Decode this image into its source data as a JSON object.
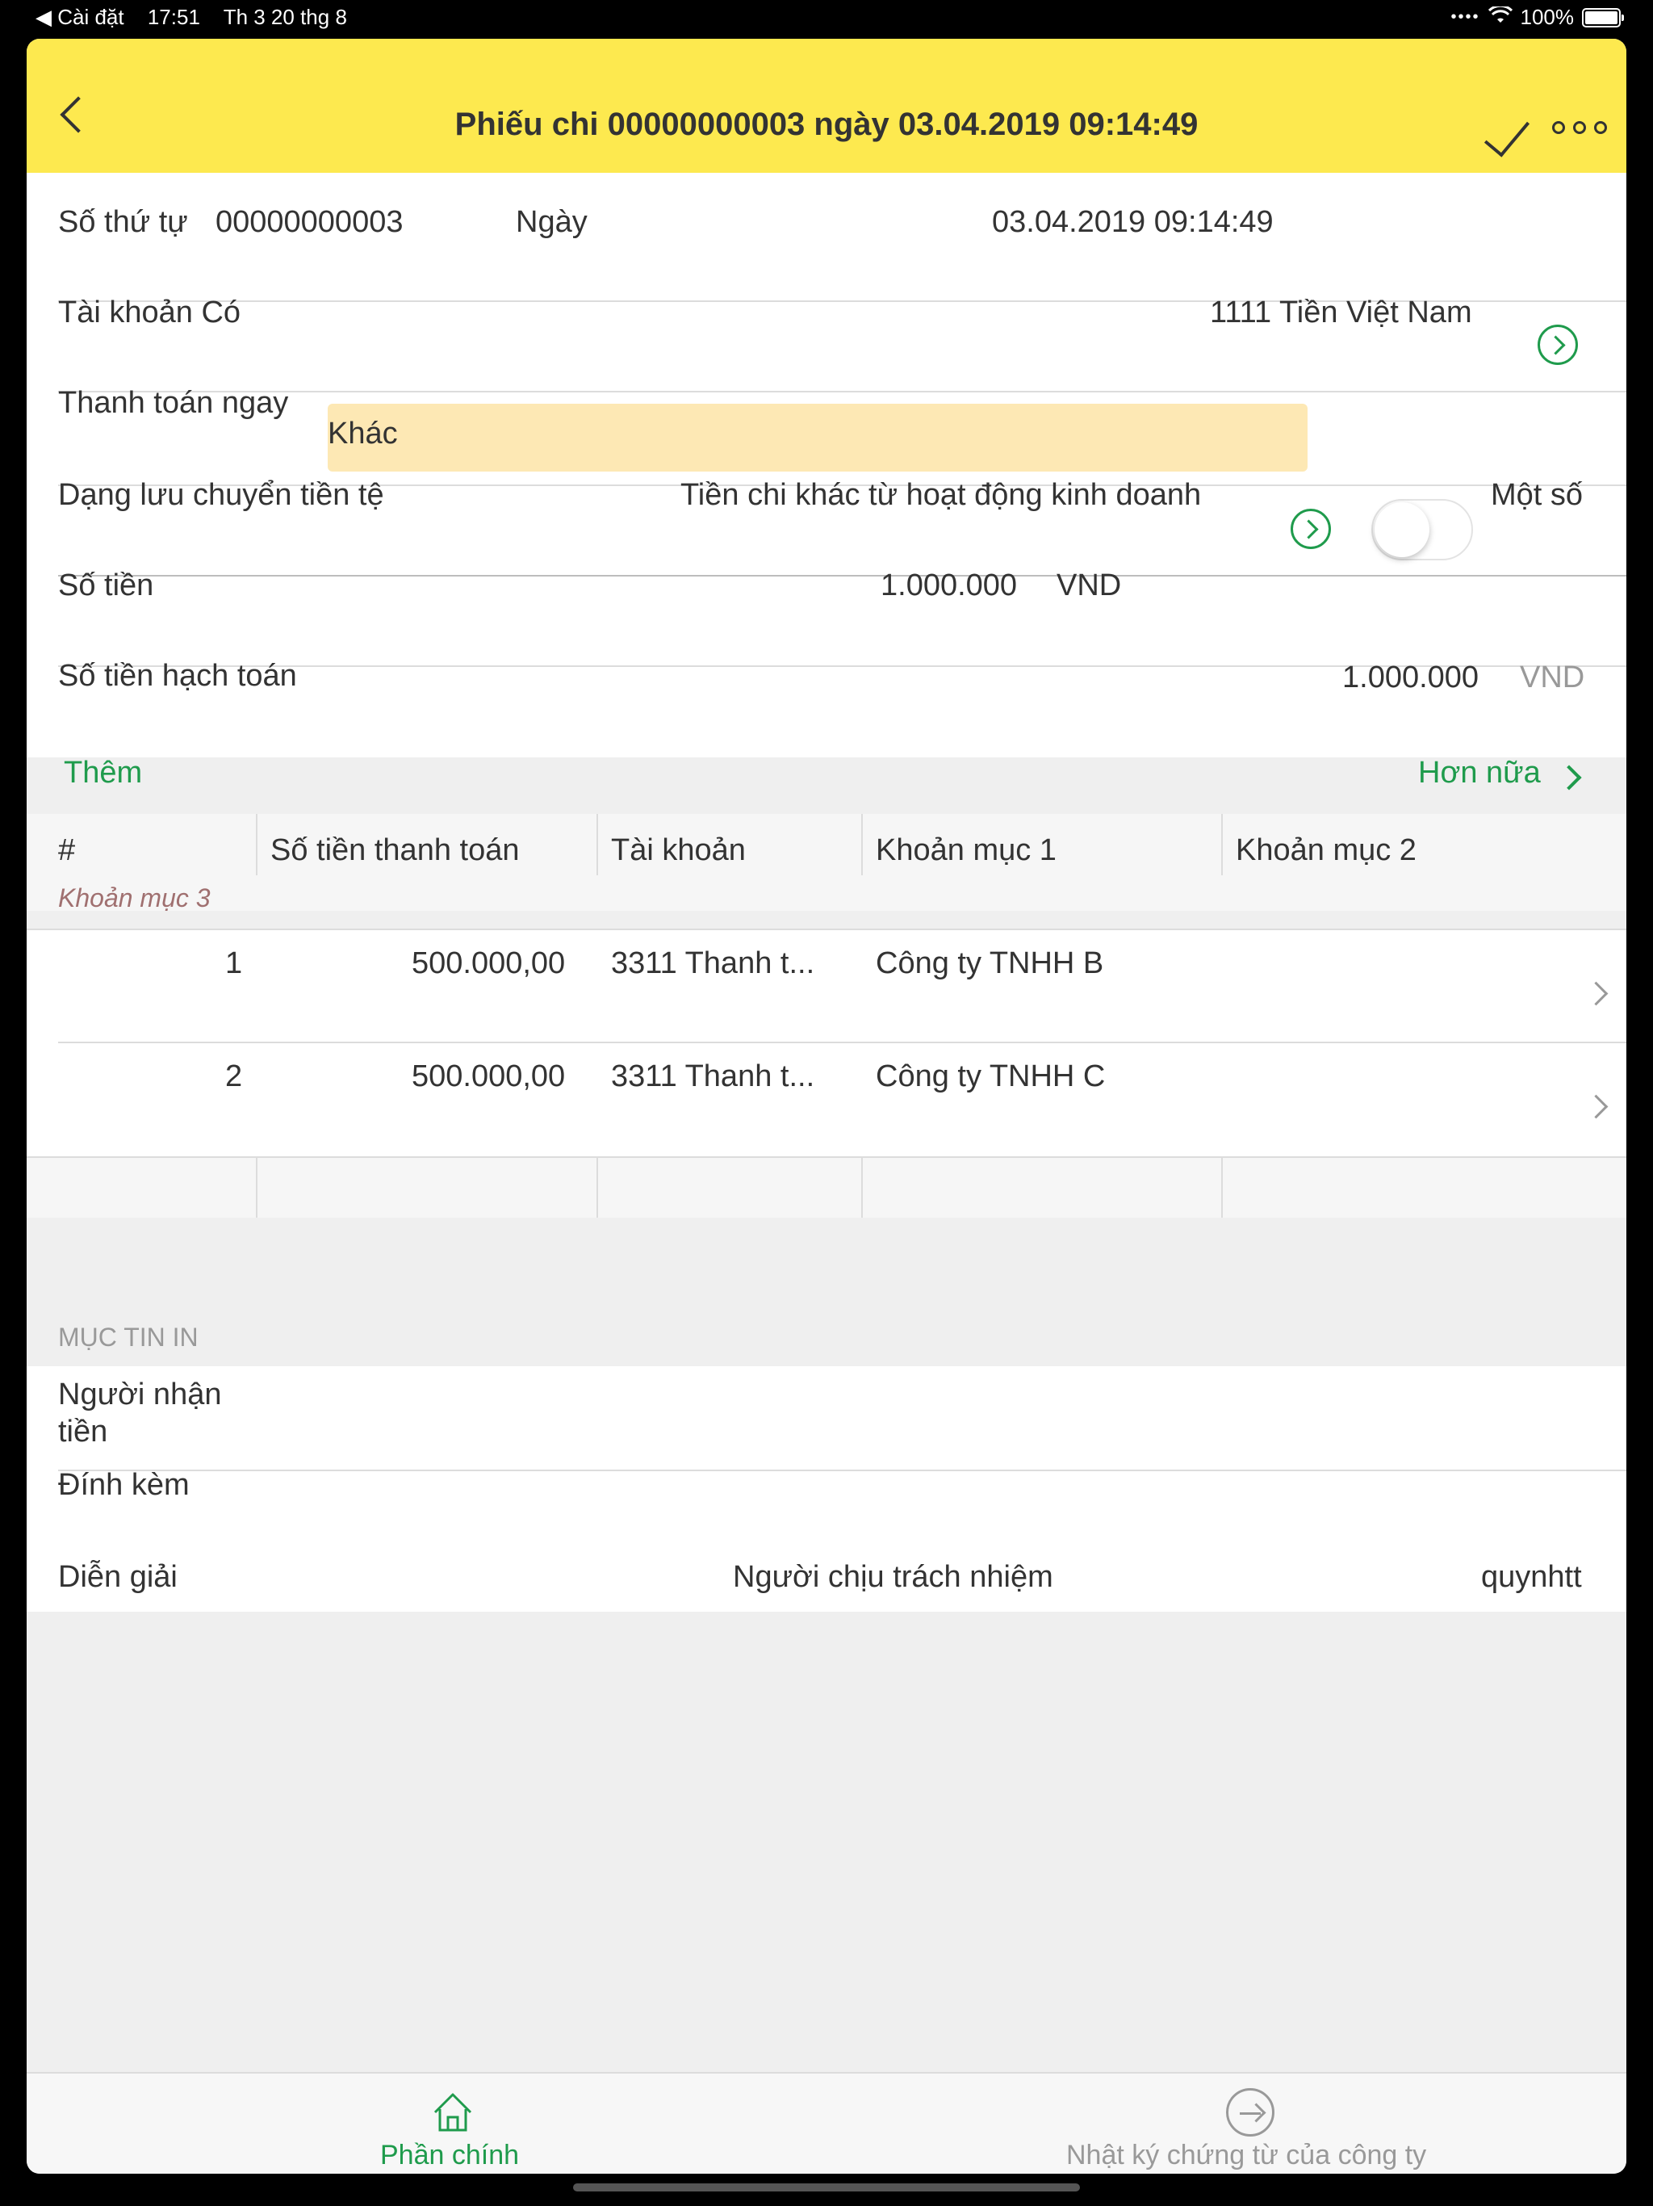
{
  "status_bar": {
    "back_app": "◀ Cài đặt",
    "time": "17:51",
    "date": "Th 3 20 thg 8",
    "battery": "100%"
  },
  "header": {
    "title": "Phiếu chi 00000000003 ngày 03.04.2019 09:14:49"
  },
  "form": {
    "so_thu_tu_label": "Số thứ tự",
    "so_thu_tu_value": "00000000003",
    "ngay_label": "Ngày",
    "ngay_value": "03.04.2019 09:14:49",
    "tai_khoan_co_label": "Tài khoản Có",
    "tai_khoan_co_value": "1111 Tiền Việt Nam",
    "thanh_toan_label": "Thanh toán ngay",
    "thanh_toan_value": "Khác",
    "dang_luu_chuyen_label": "Dạng lưu chuyển tiền tệ",
    "dang_luu_chuyen_value": "Tiền chi khác từ hoạt động kinh doanh",
    "mot_so_label": "Một số",
    "so_tien_label": "Số tiền",
    "so_tien_value": "1.000.000",
    "so_tien_currency": "VND",
    "so_tien_hach_toan_label": "Số tiền hạch toán",
    "so_tien_hach_toan_value": "1.000.000",
    "so_tien_hach_toan_currency": "VND"
  },
  "table_section": {
    "add_label": "Thêm",
    "more_label": "Hơn nữa",
    "columns": [
      "#",
      "Số tiền thanh toán",
      "Tài khoản",
      "Khoản mục 1",
      "Khoản mục 2"
    ],
    "sub_column": "Khoản mục 3",
    "rows": [
      {
        "index": "1",
        "amount": "500.000,00",
        "account": "3311 Thanh t...",
        "item1": "Công ty TNHH B"
      },
      {
        "index": "2",
        "amount": "500.000,00",
        "account": "3311 Thanh t...",
        "item1": "Công ty TNHH C"
      }
    ]
  },
  "print_section": {
    "heading": "MỤC TIN IN",
    "nguoi_nhan_label_1": "Người nhận",
    "nguoi_nhan_label_2": "tiền",
    "dinh_kem_label": "Đính kèm",
    "dien_giai_label": "Diễn giải",
    "nguoi_chiu_label": "Người chịu trách nhiệm",
    "nguoi_chiu_value": "quynhtt"
  },
  "tabs": {
    "main": "Phần chính",
    "journal": "Nhật ký chứng từ của công ty"
  },
  "colors": {
    "header_bg": "#fde94f",
    "accent": "#1f9b4c",
    "highlight": "#fde8b4"
  }
}
